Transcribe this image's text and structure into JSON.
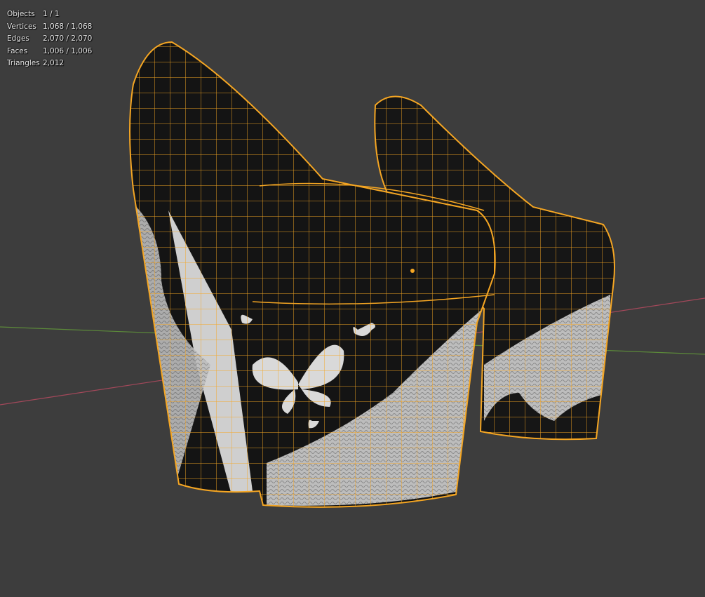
{
  "stats": {
    "objects": {
      "label": "Objects",
      "value": "1 / 1"
    },
    "vertices": {
      "label": "Vertices",
      "value": "1,068 / 1,068"
    },
    "edges": {
      "label": "Edges",
      "value": "2,070 / 2,070"
    },
    "faces": {
      "label": "Faces",
      "value": "1,006 / 1,006"
    },
    "triangles": {
      "label": "Triangles",
      "value": "2,012"
    }
  },
  "colors": {
    "background": "#3d3d3d",
    "wireframe_selected": "#f5a623",
    "x_axis": "#a3485a",
    "y_axis": "#5c8a3a",
    "mesh_dark": "#151515",
    "mesh_light": "#c8c8c8"
  }
}
